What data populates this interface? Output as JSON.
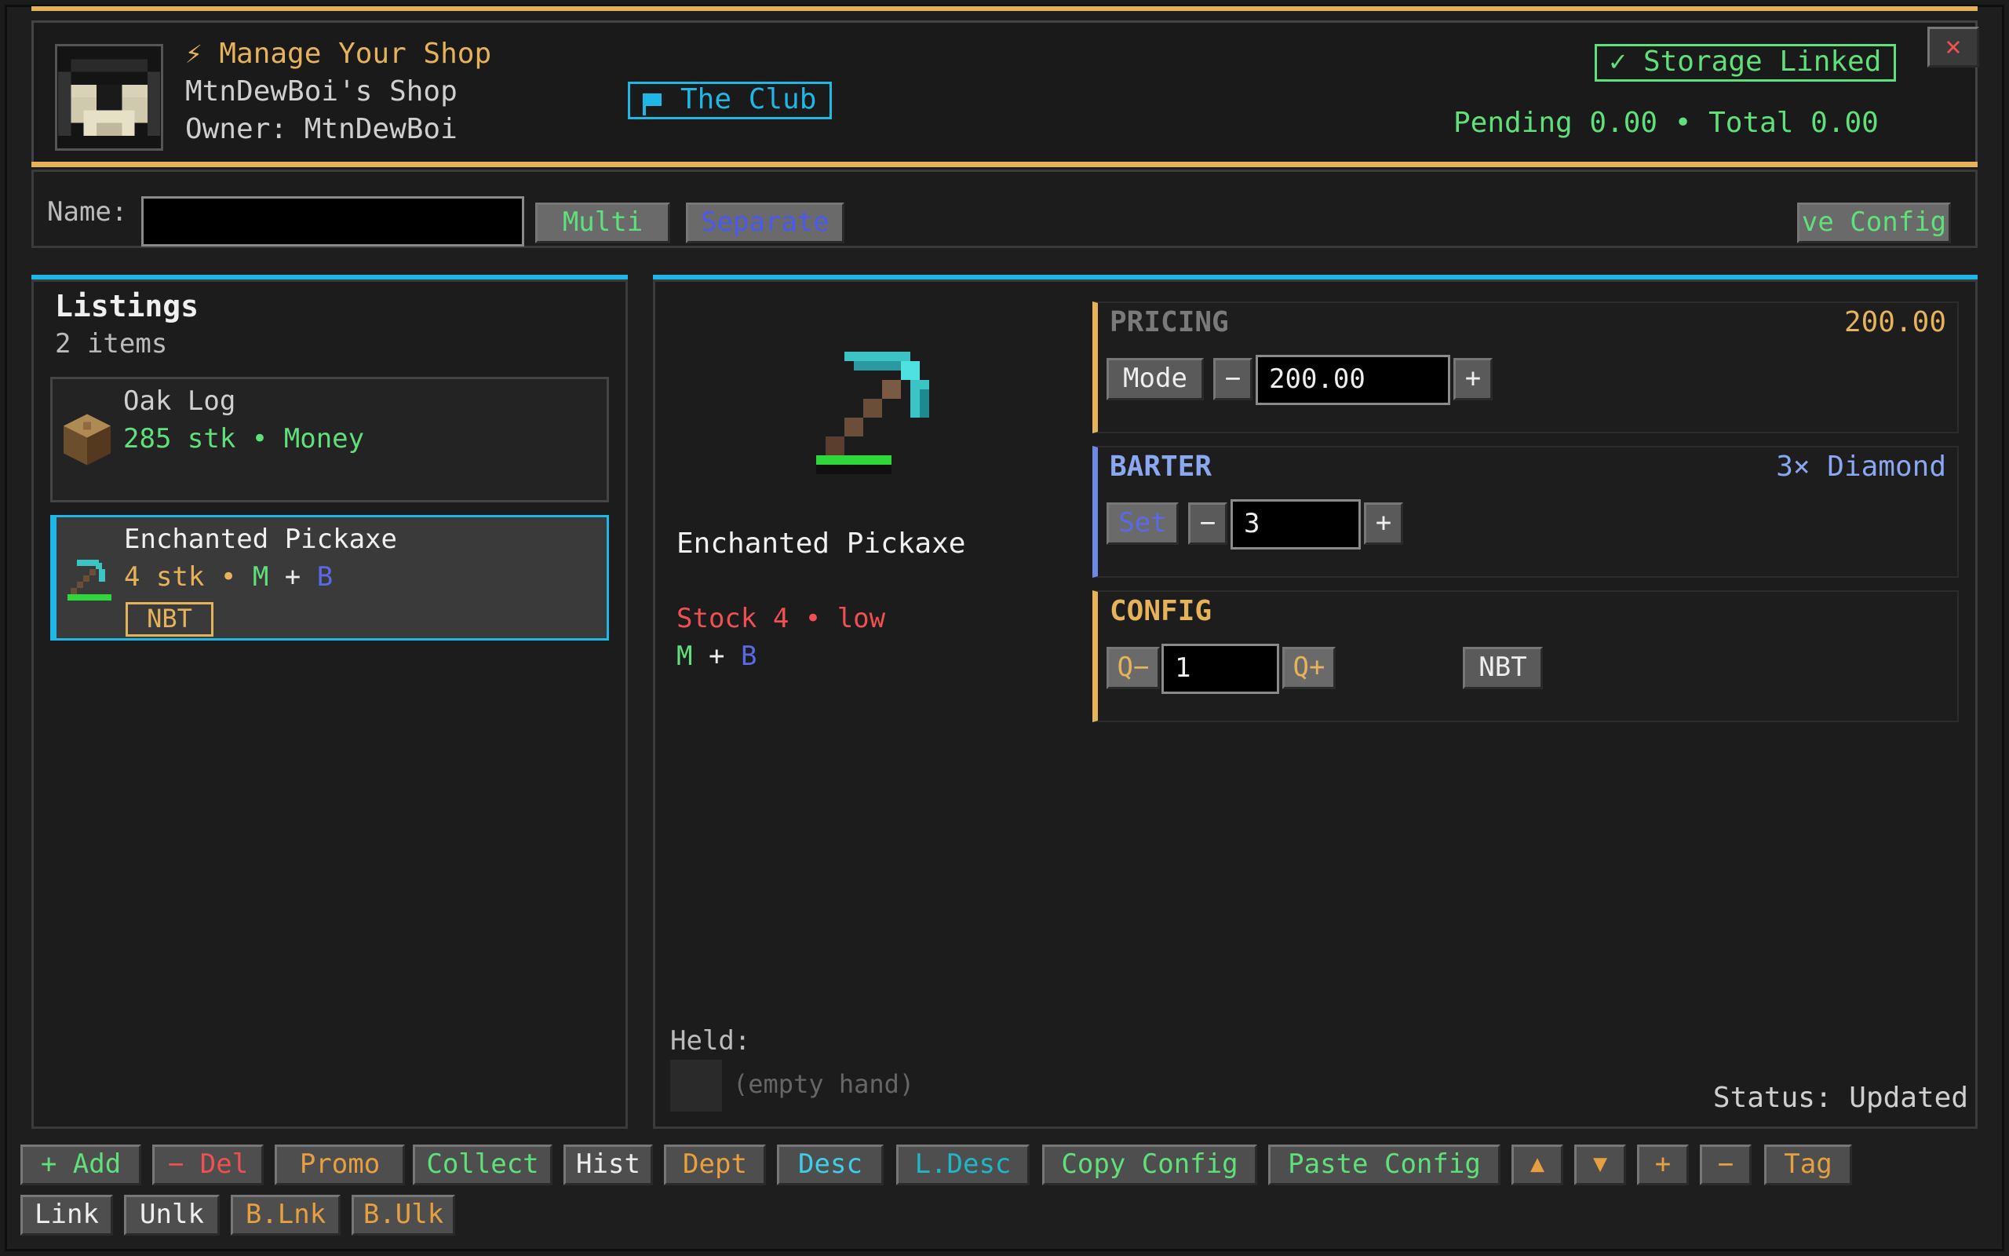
{
  "header": {
    "title": "⚡ Manage Your Shop",
    "shop_name": "MtnDewBoi's Shop",
    "owner": "Owner: MtnDewBoi",
    "club_label": "The Club",
    "storage_label": "✓ Storage Linked",
    "totals": "Pending 0.00 • Total 0.00",
    "close_label": "✕"
  },
  "namebar": {
    "name_label": "Name:",
    "name_value": "",
    "multi_label": "Multi",
    "separate_label": "Separate",
    "save_config_label": "ve Config"
  },
  "listings": {
    "title": "Listings",
    "count": "2 items",
    "items": [
      {
        "name": "Oak Log",
        "stock": "285 stk",
        "dot": "•",
        "mode": "Money"
      },
      {
        "name": "Enchanted Pickaxe",
        "stock": "4 stk",
        "dot": "•",
        "m": "M",
        "plus": "+",
        "b": "B",
        "tag": "NBT"
      }
    ]
  },
  "detail": {
    "item_name": "Enchanted Pickaxe",
    "stock_line": "Stock 4 • low",
    "m": "M",
    "plus": "+",
    "b": "B",
    "held_label": "Held:",
    "held_value": "(empty hand)",
    "status": "Status: Updated"
  },
  "pricing": {
    "title": "PRICING",
    "value": "200.00",
    "mode_label": "Mode",
    "minus": "−",
    "price_input": "200.00",
    "plus": "+"
  },
  "barter": {
    "title": "BARTER",
    "summary": "3× Diamond",
    "set_label": "Set",
    "minus": "−",
    "qty_input": "3",
    "plus": "+"
  },
  "config": {
    "title": "CONFIG",
    "qminus_label": "Q−",
    "qty_input": "1",
    "qplus_label": "Q+",
    "nbt_label": "NBT"
  },
  "toolbar": {
    "row1": [
      "+ Add",
      "− Del",
      "Promo",
      "Collect",
      "Hist",
      "Dept",
      "Desc",
      "L.Desc",
      "Copy Config",
      "Paste Config",
      "▲",
      "▼",
      "+",
      "−",
      "Tag"
    ],
    "row2": [
      "Link",
      "Unlk",
      "B.Lnk",
      "B.Ulk"
    ]
  },
  "colors": {
    "accent_gold": "#e6b25a",
    "accent_cyan": "#1fb7e6",
    "green": "#5fe07a",
    "blue": "#5a6ae6",
    "red": "#f05050"
  },
  "icons": [
    "player-head-icon",
    "flag-icon",
    "oak-log-icon",
    "pickaxe-icon"
  ]
}
